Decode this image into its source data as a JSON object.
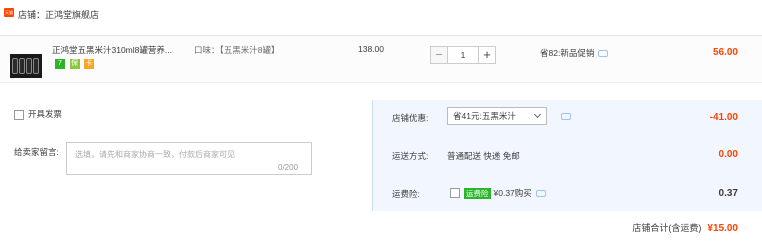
{
  "store": {
    "badge": "天猫",
    "name": "店铺：正鸿堂旗舰店"
  },
  "item": {
    "title": "正鸿堂五黑米汁310ml8罐营养...",
    "sku": "口味：【五黑米汁8罐】",
    "price": "138.00",
    "quantity": "1",
    "minus": "−",
    "plus": "+",
    "promo": "省82:新品促销",
    "subtotal": "56.00",
    "mini_icons": [
      "7",
      "保",
      "卡"
    ]
  },
  "invoice": {
    "label": "开具发票"
  },
  "message": {
    "label": "给卖家留言:",
    "placeholder": "选填，请先和商家协商一致，付款后商家可见",
    "count": "0/200"
  },
  "discount": {
    "label": "店铺优惠:",
    "selected": "省41元:五黑米汁",
    "amount": "-41.00"
  },
  "shipping": {
    "label": "运送方式:",
    "value": "普通配送 快递 免邮",
    "amount": "0.00"
  },
  "insurance": {
    "label": "运费险:",
    "badge": "运费险",
    "price": "¥0.37购买",
    "amount": "0.37"
  },
  "total": {
    "label": "店铺合计(含运费)",
    "amount": "¥15.00"
  },
  "colors": {
    "accent": "#ff4400",
    "panel": "#f2f7ff",
    "insurance_badge": "#2cb42c"
  }
}
